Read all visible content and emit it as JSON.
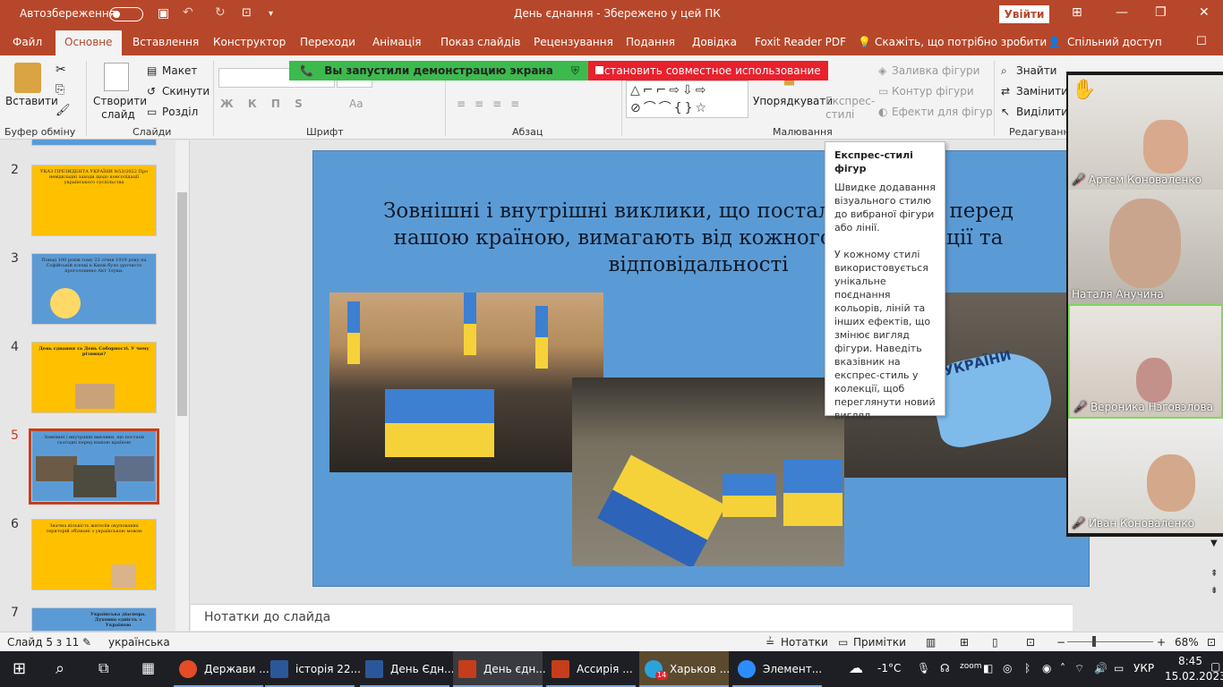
{
  "titlebar": {
    "autosave_label": "Автозбереження",
    "doc_title": "День єднання  -  Збережено у цей ПК",
    "login_label": "Увійти",
    "undo_icon": "undo-icon",
    "save_icon": "save-icon"
  },
  "tabs": [
    {
      "label": "Файл"
    },
    {
      "label": "Основне"
    },
    {
      "label": "Вставлення"
    },
    {
      "label": "Конструктор"
    },
    {
      "label": "Переходи"
    },
    {
      "label": "Анімація"
    },
    {
      "label": "Показ слайдів"
    },
    {
      "label": "Рецензування"
    },
    {
      "label": "Подання"
    },
    {
      "label": "Довідка"
    },
    {
      "label": "Foxit Reader PDF"
    },
    {
      "label": "Скажіть, що потрібно зробити"
    },
    {
      "label": "Спільний доступ"
    }
  ],
  "ribbon": {
    "paste": "Вставити",
    "new_slide": "Створити слайд",
    "layout": "Макет",
    "reset": "Скинути",
    "section": "Розділ",
    "arrange": "Упорядкувати",
    "quick_styles": "Експрес-стилі",
    "shape_fill": "Заливка фігури",
    "shape_outline": "Контур фігури",
    "shape_effects": "Ефекти для фігур",
    "find": "Знайти",
    "replace": "Замінити",
    "select": "Виділити",
    "font_buttons": "Ж  К  П  S",
    "aa_label": "Аа",
    "groups": {
      "clipboard": "Буфер обміну",
      "slides": "Слайди",
      "font": "Шрифт",
      "paragraph": "Абзац",
      "drawing": "Малювання",
      "editing": "Редагування"
    }
  },
  "screen_share": {
    "started": "Вы запустили демонстрацию экрана",
    "stop": "Остановить совместное использование"
  },
  "slides_panel": {
    "selected": 5,
    "items": [
      {
        "num": "2",
        "text": "УКАЗ ПРЕЗИДЕНТА УКРАЇНИ №53/2022 Про невідкладні заходи щодо консолідації українського суспільства"
      },
      {
        "num": "3",
        "text": "Понад 100 років тому 22 січня 1919 року на Софійській площі в Києві було урочисто проголошено Акт Злуки."
      },
      {
        "num": "4",
        "text": "День єднання та День Соборності. У чому різниця?"
      },
      {
        "num": "5",
        "text": "Зовнішні і внутрішні виклики, що постали сьогодні перед нашою країною"
      },
      {
        "num": "6",
        "text": "Значна кількість жителів окупованих територій обізнані з українською мовою"
      },
      {
        "num": "7",
        "text": "Українська діаспора. Духовна єдність з Україною"
      }
    ]
  },
  "slide": {
    "title": "Зовнішні і внутрішні виклики, що постали сьогодні перед нашою країною, вимагають від кожного консолідації та відповідальності",
    "map_text": "УКРАЇНИ"
  },
  "tooltip": {
    "heading": "Експрес-стилі фігур",
    "p1": "Швидке додавання візуального стилю до вибраної фігури або лінії.",
    "p2": "У кожному стилі використовується унікальне поєднання кольорів, ліній та інших ефектів, що змінює вигляд фігури. Наведіть вказівник на експрес-стиль у колекції, щоб переглянути новий вигляд."
  },
  "notes": {
    "placeholder": "Нотатки до слайда"
  },
  "participants": [
    {
      "name": "Артем Коноваленко",
      "muted": true
    },
    {
      "name": "Наталя Анучина",
      "muted": false
    },
    {
      "name": "Вероника Нэговэлова",
      "muted": true
    },
    {
      "name": "Иван Коноваленко",
      "muted": true
    }
  ],
  "status": {
    "slide_counter": "Слайд 5 з 11",
    "language": "українська",
    "notes": "Нотатки",
    "comments": "Примітки",
    "zoom": "68%"
  },
  "taskbar": {
    "items": [
      {
        "label": "Держави ...",
        "color": "#e34c26"
      },
      {
        "label": "історія 22...",
        "color": "#2b579a"
      },
      {
        "label": "День Єдн...",
        "color": "#2b579a"
      },
      {
        "label": "День єдн...",
        "color": "#c43e1c"
      },
      {
        "label": "Ассирія ...",
        "color": "#c43e1c"
      },
      {
        "label": "Харьков ...",
        "color": "#2aa3dc"
      },
      {
        "label": "Элемент...",
        "color": "#2d8cff"
      }
    ],
    "telegram_badge": "14",
    "weather": "-1°C",
    "lang": "УКР",
    "time": "8:45",
    "date": "15.02.2023"
  },
  "colors": {
    "accent": "#b7472a",
    "share_green": "#3dba4e",
    "share_red": "#e8212d",
    "slide_bg": "#5b9bd5"
  }
}
